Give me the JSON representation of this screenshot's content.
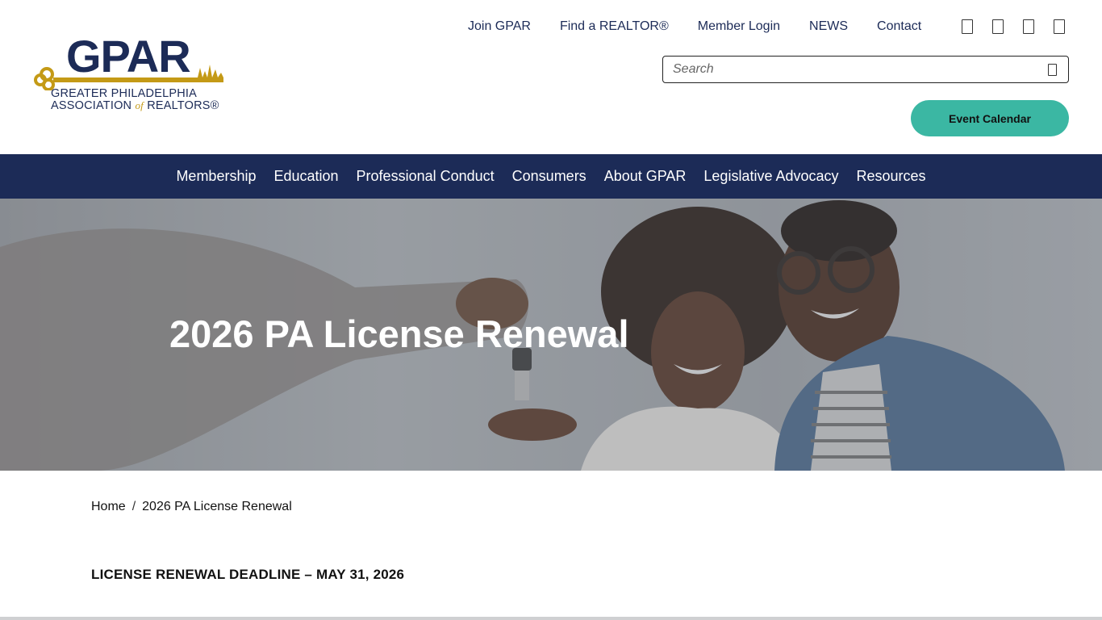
{
  "logo": {
    "wordmark": "GPAR",
    "line1": "GREATER PHILADELPHIA",
    "line2_a": "ASSOCIATION ",
    "line2_of": "of",
    "line2_b": " REALTORS®",
    "colors": {
      "navy": "#1c2b57",
      "gold": "#c49a16"
    }
  },
  "topnav": {
    "items": [
      {
        "label": "Join GPAR"
      },
      {
        "label": "Find a REALTOR®"
      },
      {
        "label": "Member Login"
      },
      {
        "label": "NEWS"
      },
      {
        "label": "Contact"
      }
    ]
  },
  "social": {
    "icons": [
      "social-icon-1",
      "social-icon-2",
      "social-icon-3",
      "social-icon-4"
    ]
  },
  "search": {
    "placeholder": "Search",
    "icon": "search-icon"
  },
  "event_button": {
    "label": "Event Calendar",
    "color": "#3bb7a3"
  },
  "mainnav": {
    "background": "#1c2b57",
    "items": [
      {
        "label": "Membership"
      },
      {
        "label": "Education"
      },
      {
        "label": "Professional Conduct"
      },
      {
        "label": "Consumers"
      },
      {
        "label": "About GPAR"
      },
      {
        "label": "Legislative Advocacy"
      },
      {
        "label": "Resources"
      }
    ]
  },
  "hero": {
    "title": "2026 PA License Renewal"
  },
  "breadcrumb": {
    "home": "Home",
    "separator": "/",
    "current": "2026 PA License Renewal"
  },
  "content": {
    "heading": "LICENSE RENEWAL DEADLINE – MAY 31, 2026"
  }
}
